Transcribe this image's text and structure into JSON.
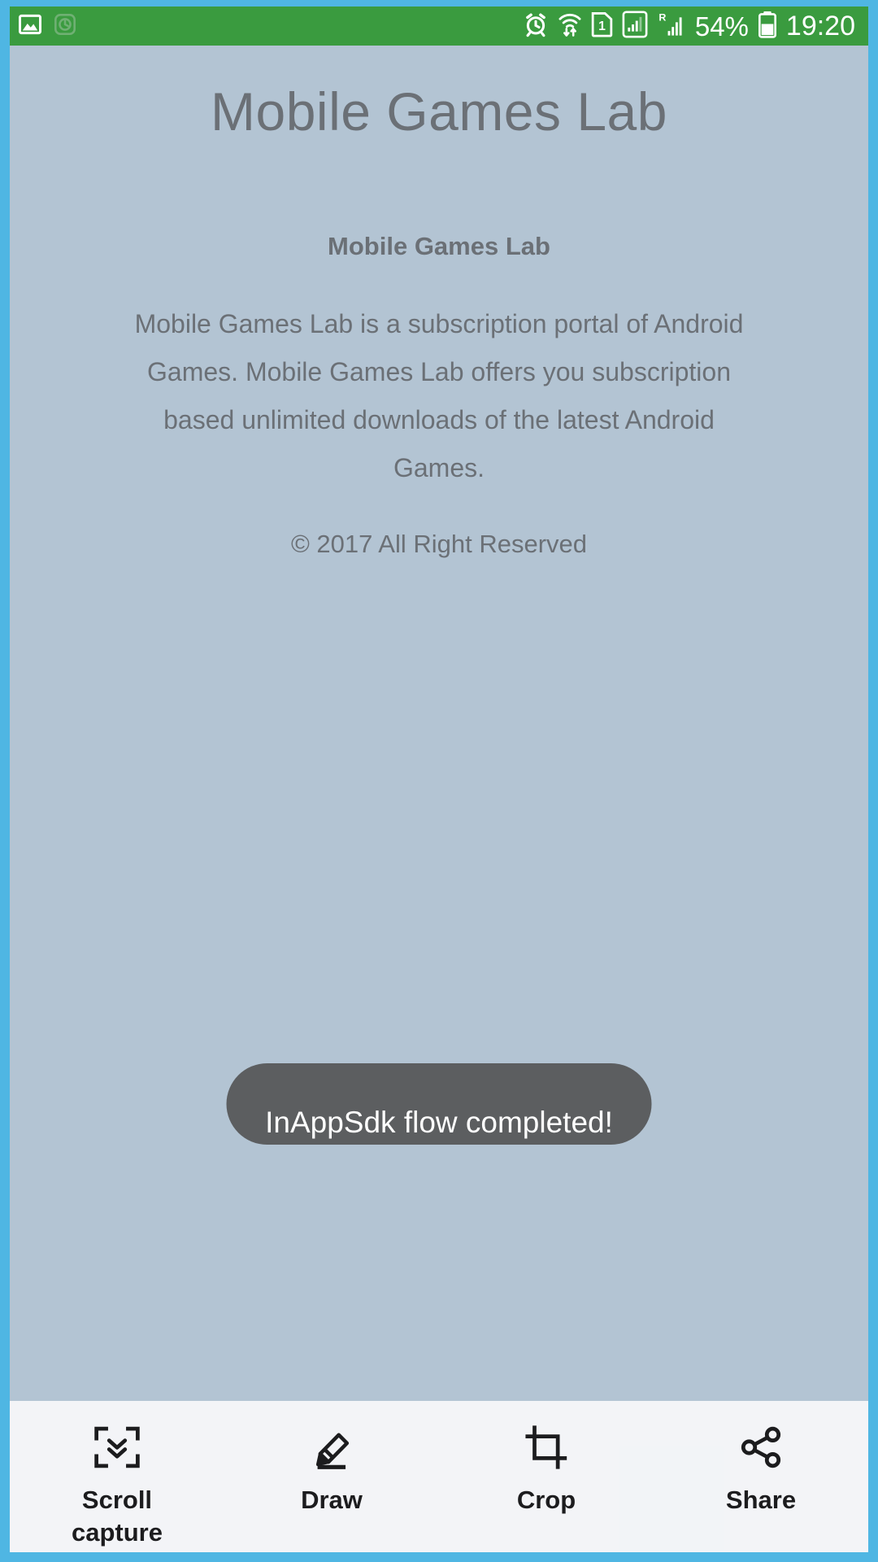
{
  "frame": {
    "border_color": "#4FB6E3"
  },
  "statusbar": {
    "background": "#3A9B3F",
    "left_icons": [
      {
        "name": "gallery-image-icon"
      },
      {
        "name": "app-notification-icon"
      }
    ],
    "right_icons": [
      {
        "name": "alarm-clock-icon"
      },
      {
        "name": "wifi-data-transfer-icon"
      },
      {
        "name": "sim-card-1-icon"
      },
      {
        "name": "signal-boxed-icon"
      },
      {
        "name": "roaming-signal-icon"
      }
    ],
    "battery_percent": "54%",
    "battery_icon": "battery-half-icon",
    "clock": "19:20"
  },
  "page": {
    "title": "Mobile Games Lab",
    "section_title": "Mobile Games Lab",
    "body": "Mobile Games Lab is a subscription portal of Android Games. Mobile Games Lab offers you subscription based unlimited downloads of the latest Android Games.",
    "copyright": "© 2017 All Right Reserved",
    "background": "#B3C4D3",
    "text_color": "#6B7076"
  },
  "toast": {
    "message": "InAppSdk flow completed!",
    "background": "#5C5E60"
  },
  "toolbar": {
    "background": "#F7F8FA",
    "items": [
      {
        "label": "Scroll\ncapture",
        "label_line1": "Scroll",
        "label_line2": "capture",
        "icon": "scroll-capture-icon"
      },
      {
        "label": "Draw",
        "label_line1": "Draw",
        "label_line2": "",
        "icon": "draw-pen-icon"
      },
      {
        "label": "Crop",
        "label_line1": "Crop",
        "label_line2": "",
        "icon": "crop-icon"
      },
      {
        "label": "Share",
        "label_line1": "Share",
        "label_line2": "",
        "icon": "share-nodes-icon"
      }
    ]
  }
}
